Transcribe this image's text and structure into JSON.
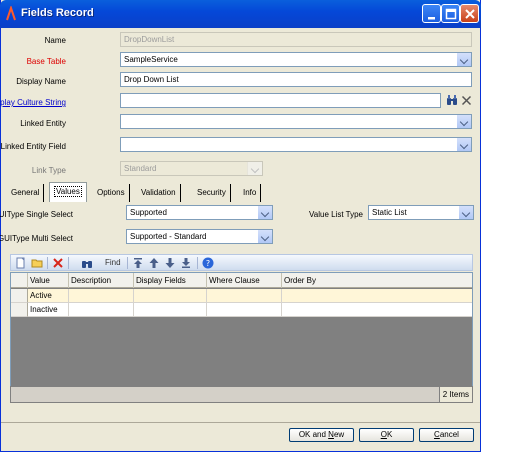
{
  "window": {
    "title": "Fields Record"
  },
  "fields": {
    "name": {
      "label": "Name",
      "value": "DropDownList"
    },
    "base_table": {
      "label": "Base Table",
      "value": "SampleService"
    },
    "display_name": {
      "label": "Display Name",
      "value": "Drop Down List"
    },
    "display_culture": {
      "label": "Display Culture String",
      "value": ""
    },
    "linked_entity": {
      "label": "Linked Entity",
      "value": ""
    },
    "linked_entity_field": {
      "label": "Linked Entity Field",
      "value": ""
    },
    "link_type": {
      "label": "Link Type",
      "value": "Standard"
    }
  },
  "tabs": [
    "General",
    "Values",
    "Options",
    "Validation",
    "Security",
    "Info"
  ],
  "active_tab": "Values",
  "values_tab": {
    "single_select": {
      "label": "GUIType Single Select",
      "value": "Supported"
    },
    "multi_select": {
      "label": "GUIType Multi Select",
      "value": "Supported - Standard"
    },
    "value_list_type": {
      "label": "Value List Type",
      "value": "Static List"
    }
  },
  "toolbar": {
    "find_label": "Find"
  },
  "grid": {
    "columns": [
      "Value",
      "Description",
      "Display Fields",
      "Where Clause",
      "Order By"
    ],
    "rows": [
      [
        "Active",
        "",
        "",
        "",
        ""
      ],
      [
        "Inactive",
        "",
        "",
        "",
        ""
      ]
    ]
  },
  "status": {
    "count": "2 Items"
  },
  "buttons": {
    "ok_new_pre": "OK and ",
    "ok_new_u": "N",
    "ok_new_post": "ew",
    "ok_u": "O",
    "ok_post": "K",
    "cancel_u": "C",
    "cancel_post": "ancel"
  },
  "colors": {
    "title_bar": "#0a5fdc",
    "required_label": "#dd0000",
    "link_label": "#0000cc",
    "grid_background": "#808080"
  }
}
